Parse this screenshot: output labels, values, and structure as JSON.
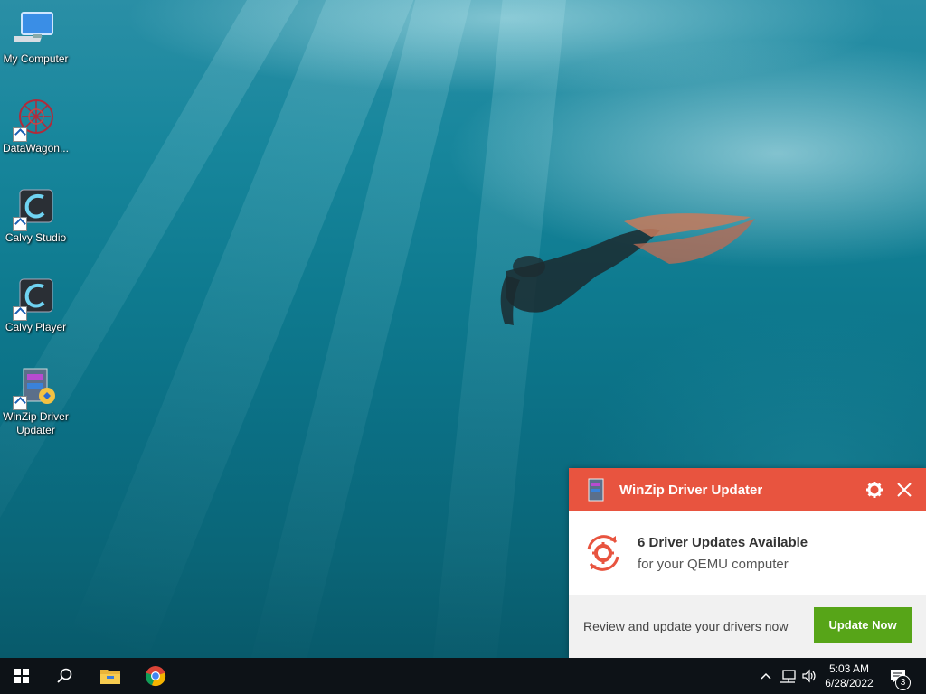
{
  "desktop": {
    "icons": [
      {
        "label": "My Computer",
        "icon": "computer-icon"
      },
      {
        "label": "DataWagon...",
        "icon": "datawagon-icon"
      },
      {
        "label": "Calvy Studio",
        "icon": "calvy-studio-icon"
      },
      {
        "label": "Calvy Player",
        "icon": "calvy-player-icon"
      },
      {
        "label": "WinZip Driver Updater",
        "icon": "winzip-driver-updater-icon"
      }
    ]
  },
  "notification": {
    "app_title": "WinZip Driver Updater",
    "heading": "6 Driver Updates Available",
    "subtext": "for your QEMU computer",
    "footer_message": "Review and update your drivers now",
    "button_label": "Update Now",
    "colors": {
      "header": "#e8543f",
      "button": "#57a518"
    }
  },
  "taskbar": {
    "pinned": [
      "start-icon",
      "search-icon",
      "file-explorer-icon",
      "chrome-icon"
    ],
    "tray": {
      "time": "5:03 AM",
      "date": "6/28/2022",
      "notification_count": "3"
    }
  }
}
